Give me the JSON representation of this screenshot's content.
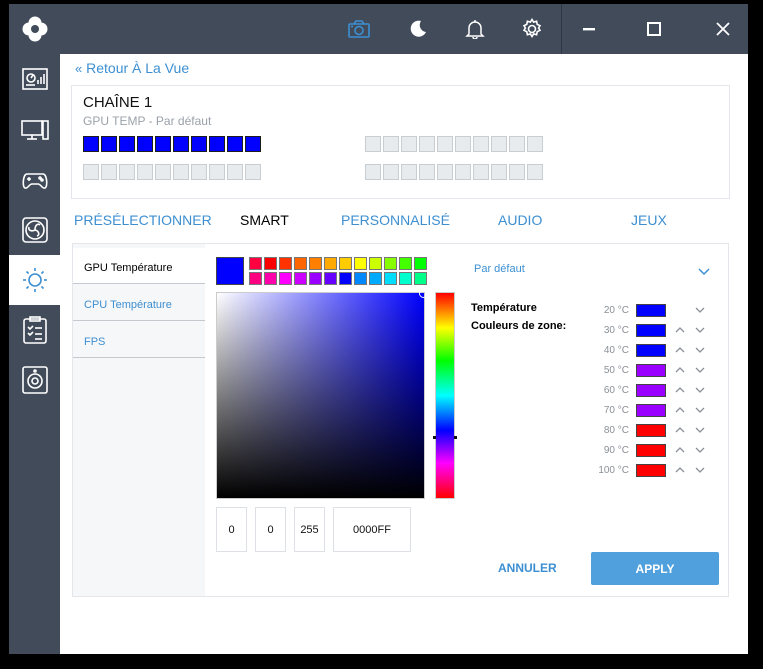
{
  "back_link": "Retour À La Vue",
  "chain": {
    "title": "CHAÎNE 1",
    "subtitle": "GPU TEMP - Par défaut",
    "led_color": "#0000FF"
  },
  "tabs": [
    {
      "label": "PRÉSÉLECTIONNER"
    },
    {
      "label": "SMART"
    },
    {
      "label": "PERSONNALISÉ"
    },
    {
      "label": "AUDIO"
    },
    {
      "label": "JEUX"
    }
  ],
  "sensors": [
    {
      "label": "GPU Température"
    },
    {
      "label": "CPU Température"
    },
    {
      "label": "FPS"
    }
  ],
  "picker": {
    "current_color": "#0000FF",
    "palette_row1": [
      "#ff0040",
      "#ff0000",
      "#ff3300",
      "#ff6600",
      "#ff8000",
      "#ffaa00",
      "#ffcc00",
      "#ffff00",
      "#ccff00",
      "#88ff00",
      "#44ff00",
      "#00ff00"
    ],
    "palette_row2": [
      "#ff0080",
      "#ff00aa",
      "#ff00ff",
      "#cc00ff",
      "#9900ff",
      "#6600ff",
      "#0000ff",
      "#0088ff",
      "#00aaff",
      "#00ddff",
      "#00ffcc",
      "#00ff88"
    ],
    "r": "0",
    "g": "0",
    "b": "255",
    "hex": "0000FF"
  },
  "preset": {
    "label": "Par défaut"
  },
  "temperature_label": "Température",
  "zone_label": "Couleurs de zone:",
  "zones": [
    {
      "temp": "20 °C",
      "color": "#0000ff"
    },
    {
      "temp": "30 °C",
      "color": "#0000ff"
    },
    {
      "temp": "40 °C",
      "color": "#0000ff"
    },
    {
      "temp": "50 °C",
      "color": "#9900ff"
    },
    {
      "temp": "60 °C",
      "color": "#9900ff"
    },
    {
      "temp": "70 °C",
      "color": "#9900ff"
    },
    {
      "temp": "80 °C",
      "color": "#ff0000"
    },
    {
      "temp": "90 °C",
      "color": "#ff0000"
    },
    {
      "temp": "100 °C",
      "color": "#ff0000"
    }
  ],
  "buttons": {
    "cancel": "ANNULER",
    "apply": "APPLY"
  },
  "colors": {
    "accent": "#3d8fd1",
    "chrome": "#414b5a",
    "apply_bg": "#4fa0dc",
    "active_icon": "#3d8fd1"
  },
  "icons": {
    "logo": "logo-icon",
    "sidebar": [
      "dashboard-icon",
      "monitor-icon",
      "gamepad-icon",
      "fan-icon",
      "lighting-icon",
      "checklist-icon",
      "speaker-icon"
    ],
    "topbar": [
      "camera-icon",
      "moon-icon",
      "bell-icon",
      "gear-icon",
      "minimize-icon",
      "maximize-icon",
      "close-icon"
    ]
  }
}
